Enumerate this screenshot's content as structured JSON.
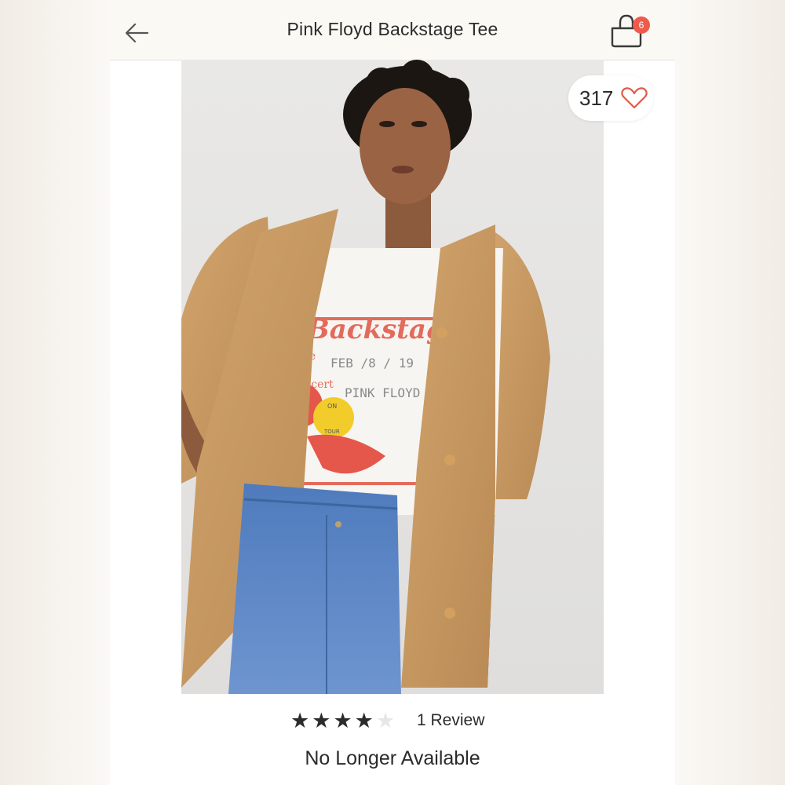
{
  "header": {
    "title": "Pink Floyd Backstage Tee",
    "back_icon": "arrow-left-icon",
    "cart_icon": "shopping-bag-icon",
    "cart_count": "6"
  },
  "product": {
    "image_description_icon": "product-photo",
    "likes": "317",
    "like_icon": "heart-outline-icon",
    "rating": 4,
    "rating_max": 5,
    "reviews_label": "1 Review",
    "status": "No Longer Available",
    "shirt_text": {
      "headline": "Backstage",
      "date_label": "date",
      "date_value": "FEB /8 / 19",
      "concert_label": "concert",
      "band": "PINK FLOYD",
      "ball_text": "ON",
      "ball_text_2": "TOUR"
    }
  },
  "colors": {
    "badge": "#ef5a4c",
    "heart": "#e25a4a",
    "text": "#2b2b2b",
    "coat": "#c9985f",
    "denim": "#5b85c2"
  }
}
